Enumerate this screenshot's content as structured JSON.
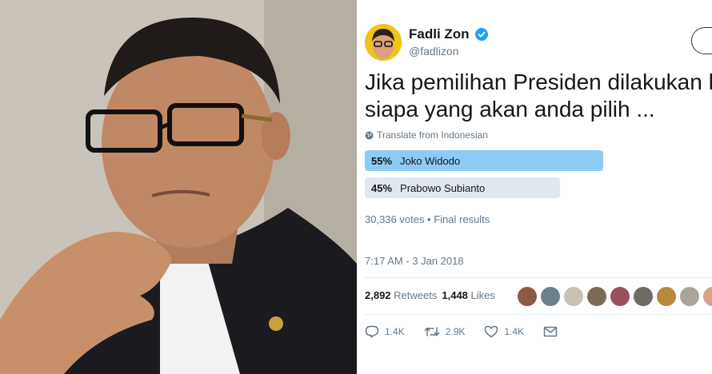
{
  "tweet": {
    "author_name": "Fadli Zon",
    "author_handle": "@fadlizon",
    "text_line1": "Jika pemilihan Presiden dilakukan hari",
    "text_line2": "siapa yang akan anda pilih ...",
    "translate_label": "Translate from Indonesian",
    "poll": [
      {
        "percent": "55%",
        "label": "Joko Widodo",
        "value": 55,
        "color": "#8dcbf4"
      },
      {
        "percent": "45%",
        "label": "Prabowo Subianto",
        "value": 45,
        "color": "#e1e8ed"
      }
    ],
    "poll_meta": "30,336 votes • Final results",
    "timestamp": "7:17 AM - 3 Jan 2018",
    "retweets_count": "2,892",
    "retweets_label": "Retweets",
    "likes_count": "1,448",
    "likes_label": "Likes",
    "actions": {
      "reply_count": "1.4K",
      "retweet_count": "2.9K",
      "like_count": "1.4K"
    }
  },
  "colors": {
    "accent": "#1da1f2",
    "poll_winner": "#8dcbf4",
    "poll_other": "#e1e8ed"
  }
}
